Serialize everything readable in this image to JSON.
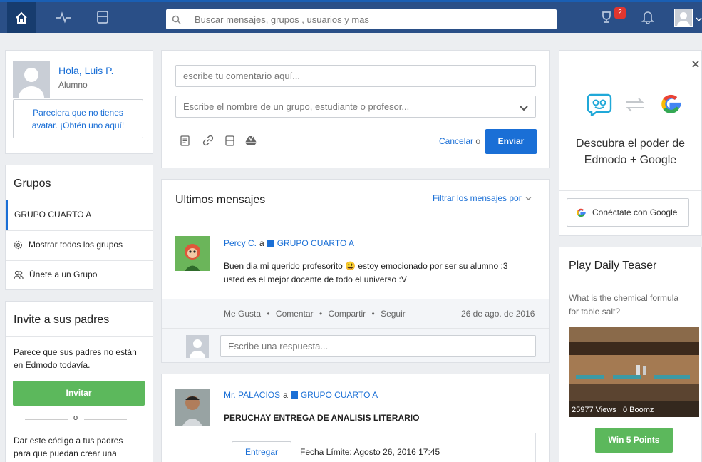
{
  "search": {
    "placeholder": "Buscar mensajes, grupos , usuarios y mas"
  },
  "notifications": {
    "badge_count": "2"
  },
  "profile": {
    "greeting": "Hola, Luis P.",
    "role": "Alumno",
    "avatar_link_line1": "Pareciera que no tienes",
    "avatar_link_line2": "avatar. ¡Obtén uno aquí!"
  },
  "groups": {
    "title": "Grupos",
    "active": "GRUPO CUARTO A",
    "show_all": "Mostrar todos los grupos",
    "join": "Únete a un Grupo"
  },
  "invite": {
    "title": "Invite a sus padres",
    "text_line1": "Parece que sus padres no están",
    "text_line2": "en Edmodo todavía.",
    "button": "Invitar",
    "divider": "o",
    "code_line1": "Dar este código a tus padres",
    "code_line2": "para que puedan crear una"
  },
  "composer": {
    "comment_placeholder": "escribe tu comentario aquí...",
    "recipient_placeholder": "Escribe el nombre de un grupo, estudiante o profesor...",
    "cancel": "Cancelar",
    "cancel_sep": "o",
    "send": "Enviar"
  },
  "feed": {
    "title": "Ultimos mensajes",
    "filter": "Filtrar los mensajes por",
    "posts": [
      {
        "author": "Percy C.",
        "to": "a",
        "group": "GRUPO CUARTO A",
        "text_line1": "Buen dia mi querido profesorito 😃 estoy emocionado por ser su alumno :3",
        "text_line2": "usted es el mejor docente de todo el universo :V",
        "like": "Me Gusta",
        "comment": "Comentar",
        "share": "Compartir",
        "follow": "Seguir",
        "dot": "•",
        "date": "26 de ago. de 2016",
        "reply_placeholder": "Escribe una respuesta..."
      },
      {
        "author": "Mr. PALACIOS",
        "to": "a",
        "group": "GRUPO CUARTO A",
        "title": "PERUCHAY ENTREGA DE ANALISIS LITERARIO",
        "submit": "Entregar",
        "deadline": "Fecha Límite: Agosto 26, 2016 17:45"
      }
    ]
  },
  "promo": {
    "headline_line1": "Descubra el poder de",
    "headline_line2": "Edmodo + Google",
    "connect": "Conéctate con Google"
  },
  "teaser": {
    "title": "Play Daily Teaser",
    "question_line1": "What is the chemical formula",
    "question_line2": "for table salt?",
    "views": "25977 Views",
    "boomz": "0 Boomz",
    "button": "Win 5 Points"
  },
  "colors": {
    "nav": "#2a4f87",
    "accent": "#1a6fd6",
    "green": "#5cb85c",
    "badge": "#e0362f"
  }
}
